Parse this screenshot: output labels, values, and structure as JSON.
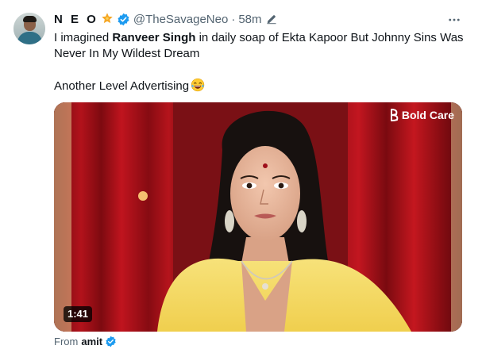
{
  "tweet": {
    "display_name": "N E O",
    "handle": "@TheSavageNeo",
    "separator": "·",
    "time": "58m",
    "text_before": "I imagined ",
    "text_bold": "Ranveer Singh",
    "text_after": " in daily soap of Ekta Kapoor But Johnny Sins Was Never In My Wildest Dream",
    "text_line2": "Another Level Advertising",
    "emoji": "laughing-tears-emoji"
  },
  "media": {
    "brand": "Bold Care",
    "duration": "1:41"
  },
  "source": {
    "prefix": "From",
    "user": "amit"
  },
  "icons": {
    "star": "star-icon",
    "verified": "verified-badge-icon",
    "edited": "edit-pencil-icon",
    "more": "more-options-icon"
  },
  "colors": {
    "verified": "#1d9bf0",
    "secondary_text": "#536471",
    "primary_text": "#0f1419",
    "star": "#f5a623"
  }
}
